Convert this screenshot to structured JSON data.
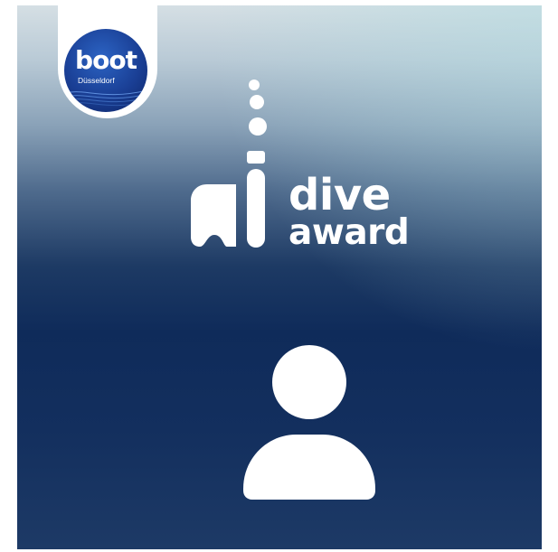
{
  "brand": {
    "logo_word": "boot",
    "logo_city": "Düsseldorf"
  },
  "award": {
    "line1": "dive",
    "line2": "award",
    "icon": "diving-mask-snorkel-icon"
  },
  "avatar": {
    "icon": "user-placeholder-icon"
  },
  "colors": {
    "background_top": "#d5dfe4",
    "background_bottom": "#0f2b5a",
    "badge_blue": "#1a3f95",
    "foreground": "#ffffff"
  }
}
